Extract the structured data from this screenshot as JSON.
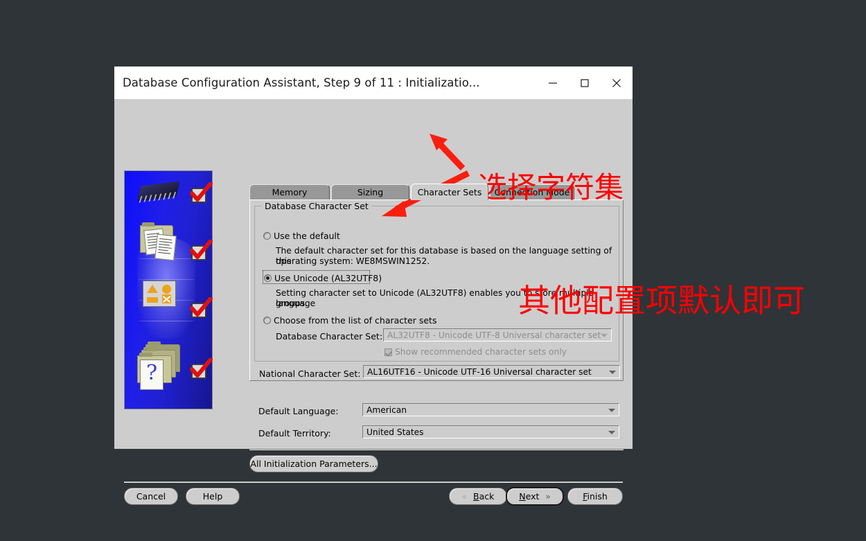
{
  "window": {
    "title": "Database Configuration Assistant, Step 9 of 11 : Initializatio...",
    "minimize_icon": "minimize-icon",
    "maximize_icon": "maximize-icon",
    "close_icon": "close-icon"
  },
  "tabs": [
    {
      "label": "Memory",
      "selected": false
    },
    {
      "label": "Sizing",
      "selected": false
    },
    {
      "label": "Character Sets",
      "selected": true
    },
    {
      "label": "Connection Mode",
      "selected": false
    }
  ],
  "group": {
    "title": "Database Character Set"
  },
  "options": {
    "use_default": {
      "label": "Use the default",
      "selected": false,
      "help_line1": "The default character set for this database is based on the language setting of this",
      "help_line2": "operating system: WE8MSWIN1252."
    },
    "use_unicode": {
      "label": "Use Unicode (AL32UTF8)",
      "selected": true,
      "focused": true,
      "help_line1": "Setting character set to Unicode (AL32UTF8) enables you to store multiple language",
      "help_line2": "groups."
    },
    "choose_from_list": {
      "label": "Choose from the list of character sets",
      "selected": false
    }
  },
  "fields": {
    "database_character_set": {
      "label": "Database Character Set:",
      "value": "AL32UTF8 - Unicode UTF-8 Universal character set",
      "disabled": true
    },
    "show_recommended": {
      "label": "Show recommended character sets only",
      "checked": true,
      "disabled": true
    },
    "national_character_set": {
      "label": "National Character Set:",
      "value": "AL16UTF16 - Unicode UTF-16 Universal character set"
    },
    "default_language": {
      "label": "Default Language:",
      "value": "American"
    },
    "default_territory": {
      "label": "Default Territory:",
      "value": "United States"
    }
  },
  "buttons": {
    "all_init_params": "All Initialization Parameters...",
    "cancel": "Cancel",
    "help": "Help",
    "back": "Back",
    "back_prefix": "B",
    "back_rest": "ack",
    "next": "Next",
    "next_prefix": "N",
    "next_rest": "ext",
    "finish": "Finish",
    "finish_prefix": "F",
    "finish_rest": "inish",
    "back_chevron": "«",
    "next_chevron": "»"
  },
  "annotations": {
    "select_charset": "选择字符集",
    "others_default": "其他配置项默认即可",
    "color": "#ff0000"
  },
  "banner": {
    "checkmarks": 4,
    "icons": [
      "chip-icon",
      "folder-documents-icon",
      "shapes-icon",
      "folders-question-icon"
    ]
  }
}
